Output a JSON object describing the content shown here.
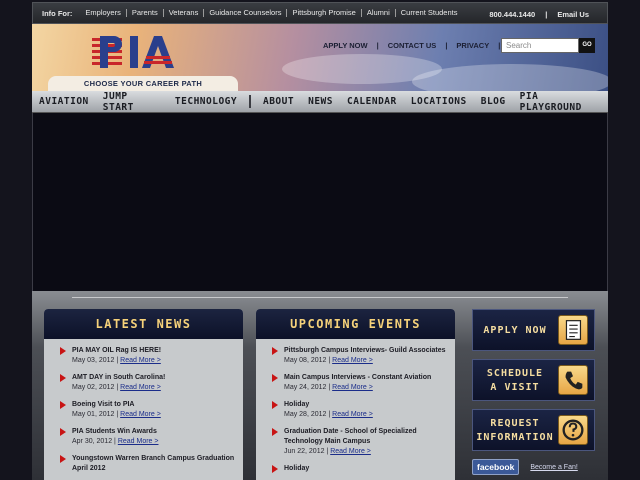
{
  "infobar": {
    "label": "Info For:",
    "links": [
      "Employers",
      "Parents",
      "Veterans",
      "Guidance Counselors",
      "Pittsburgh Promise",
      "Alumni",
      "Current Students"
    ],
    "phone": "800.444.1440",
    "separator": "|",
    "email": "Email Us"
  },
  "header": {
    "logo_text": "PIA",
    "tagline": "CHOOSE YOUR CAREER PATH",
    "top_links": [
      "APPLY NOW",
      "|",
      "CONTACT US",
      "|",
      "PRIVACY",
      "|"
    ],
    "search_placeholder": "Search",
    "go_label": "GO"
  },
  "nav": {
    "left": [
      "AVIATION",
      "JUMP START",
      "TECHNOLOGY"
    ],
    "divider": "|",
    "right": [
      "ABOUT",
      "NEWS",
      "CALENDAR",
      "LOCATIONS",
      "BLOG",
      "PIA PLAYGROUND"
    ]
  },
  "news": {
    "title": "LATEST NEWS",
    "items": [
      {
        "title": "PIA MAY OIL Rag IS HERE!",
        "date": "May 03, 2012 |",
        "more": "Read More >"
      },
      {
        "title": "AMT DAY in South Carolina!",
        "date": "May 02, 2012 |",
        "more": "Read More >"
      },
      {
        "title": "Boeing Visit to PIA",
        "date": "May 01, 2012 |",
        "more": "Read More >"
      },
      {
        "title": "PIA Students Win Awards",
        "date": "Apr 30, 2012 |",
        "more": "Read More >"
      },
      {
        "title": "Youngstown Warren Branch Campus Graduation April 2012",
        "date": "",
        "more": ""
      }
    ]
  },
  "events": {
    "title": "UPCOMING EVENTS",
    "items": [
      {
        "title": "Pittsburgh Campus Interviews- Guild Associates",
        "date": "May 08, 2012 |",
        "more": "Read More >"
      },
      {
        "title": "Main Campus Interviews - Constant Aviation",
        "date": "May 24, 2012 |",
        "more": "Read More >"
      },
      {
        "title": "Holiday",
        "date": "May 28, 2012 |",
        "more": "Read More >"
      },
      {
        "title": "Graduation Date - School of Specialized Technology Main Campus",
        "date": "Jun 22, 2012 |",
        "more": "Read More >"
      },
      {
        "title": "Holiday",
        "date": "",
        "more": ""
      }
    ]
  },
  "cta": {
    "apply": "APPLY NOW",
    "schedule_l1": "SCHEDULE",
    "schedule_l2": "A VISIT",
    "request_l1": "REQUEST",
    "request_l2": "INFORMATION",
    "apply_icon": "document-icon",
    "schedule_icon": "phone-icon",
    "request_icon": "question-icon"
  },
  "social": {
    "facebook": "facebook",
    "fan": "Become a Fan!"
  },
  "colors": {
    "navy": "#0c1128",
    "gold": "#f6d27a",
    "link": "#1b2d8a",
    "bullet": "#c81414"
  }
}
